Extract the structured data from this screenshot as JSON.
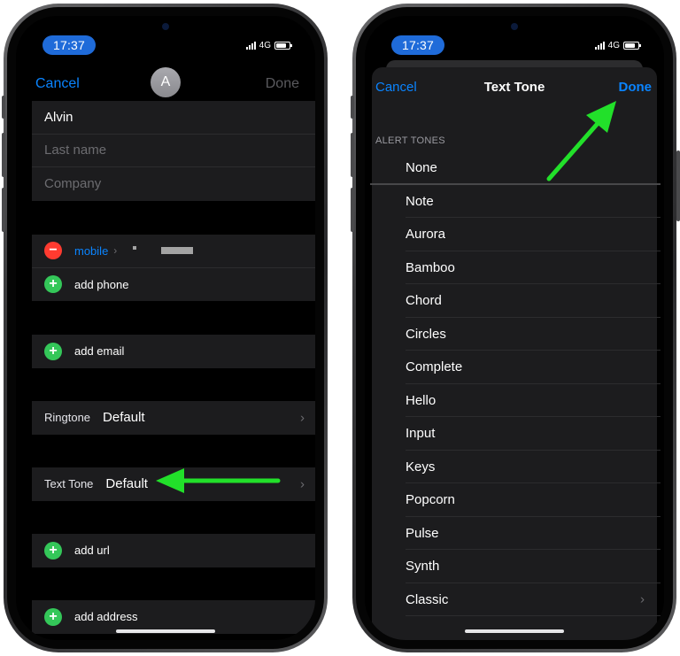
{
  "status": {
    "time": "17:37",
    "network": "4G"
  },
  "edit_contact": {
    "nav": {
      "cancel": "Cancel",
      "done": "Done",
      "avatar_initial": "A"
    },
    "name_fields": {
      "first_name": "Alvin",
      "last_name_placeholder": "Last name",
      "company_placeholder": "Company"
    },
    "phone": {
      "label": "mobile",
      "add_label": "add phone"
    },
    "email": {
      "add_label": "add email"
    },
    "ringtone": {
      "label": "Ringtone",
      "value": "Default"
    },
    "text_tone": {
      "label": "Text Tone",
      "value": "Default"
    },
    "url": {
      "add_label": "add url"
    },
    "address": {
      "add_label": "add address"
    }
  },
  "text_tone_picker": {
    "nav": {
      "cancel": "Cancel",
      "title": "Text Tone",
      "done": "Done"
    },
    "section_header": "ALERT TONES",
    "tones": [
      "None",
      "Note",
      "Aurora",
      "Bamboo",
      "Chord",
      "Circles",
      "Complete",
      "Hello",
      "Input",
      "Keys",
      "Popcorn",
      "Pulse",
      "Synth",
      "Classic"
    ]
  },
  "colors": {
    "accent": "#0a84ff",
    "annotation_arrow": "#22e02a",
    "delete": "#ff3b30",
    "add": "#34c759"
  },
  "icons": [
    "minus-circle-icon",
    "plus-circle-icon",
    "chevron-right-icon",
    "signal-icon",
    "battery-icon",
    "annotation-arrow-icon"
  ]
}
